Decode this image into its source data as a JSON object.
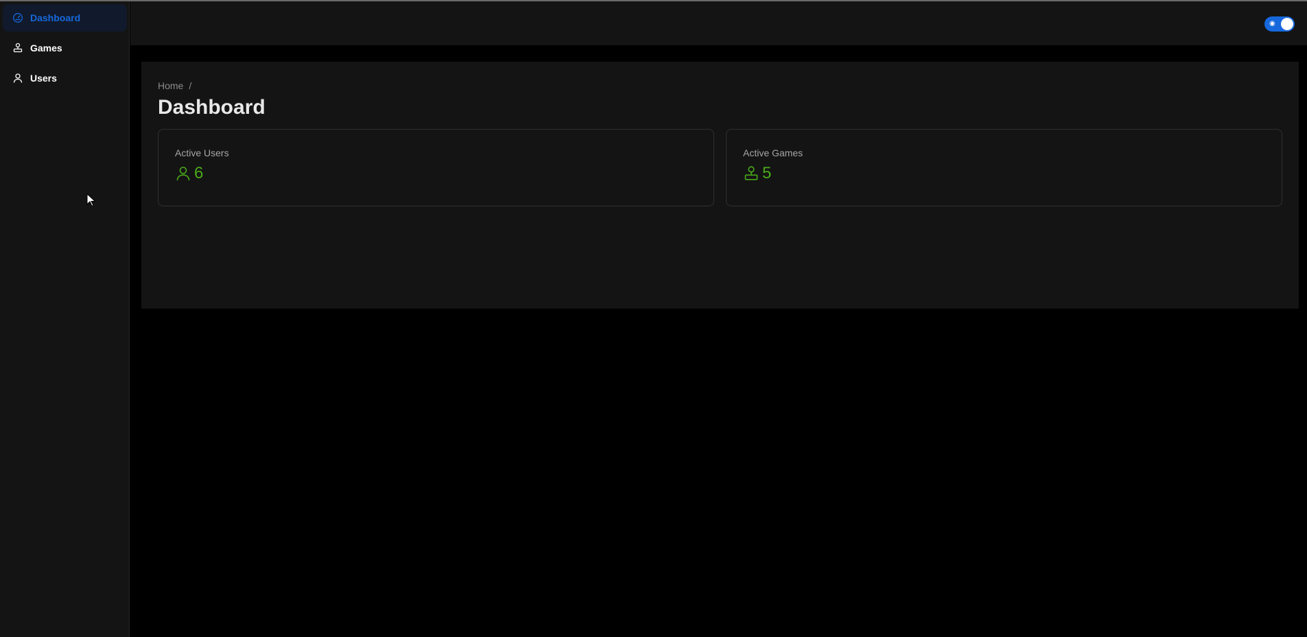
{
  "sidebar": {
    "items": [
      {
        "label": "Dashboard",
        "icon": "dashboard-icon",
        "active": true
      },
      {
        "label": "Games",
        "icon": "game-icon",
        "active": false
      },
      {
        "label": "Users",
        "icon": "user-icon",
        "active": false
      }
    ]
  },
  "header": {
    "theme_toggle": {
      "checked": true
    }
  },
  "main": {
    "breadcrumb": {
      "home": "Home",
      "separator": "/"
    },
    "title": "Dashboard",
    "stats": [
      {
        "label": "Active Users",
        "value": "6",
        "icon": "user-icon"
      },
      {
        "label": "Active Games",
        "value": "5",
        "icon": "game-icon"
      }
    ]
  },
  "colors": {
    "accent": "#1668dc",
    "stat_value": "#49aa19",
    "panel": "#141414",
    "background": "#000000"
  }
}
